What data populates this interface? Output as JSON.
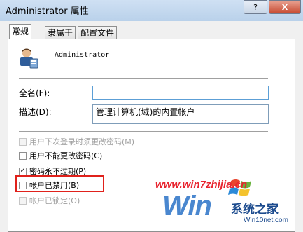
{
  "window": {
    "title": "Administrator 属性",
    "help_label": "?",
    "close_label": "X"
  },
  "tabs": [
    {
      "label": "常规",
      "active": true
    },
    {
      "label": "隶属于",
      "active": false
    },
    {
      "label": "配置文件",
      "active": false
    }
  ],
  "account": {
    "icon": "user-icon",
    "name": "Administrator"
  },
  "fields": {
    "full_name_label": "全名(F):",
    "full_name_value": "",
    "description_label": "描述(D):",
    "description_value": "管理计算机(域)的内置帐户"
  },
  "checkboxes": [
    {
      "label": "用户下次登录时须更改密码(M)",
      "checked": false,
      "enabled": false
    },
    {
      "label": "用户不能更改密码(C)",
      "checked": false,
      "enabled": true
    },
    {
      "label": "密码永不过期(P)",
      "checked": true,
      "enabled": true
    },
    {
      "label": "帐户已禁用(B)",
      "checked": false,
      "enabled": true
    },
    {
      "label": "帐户已锁定(O)",
      "checked": false,
      "enabled": false
    }
  ],
  "highlight_color": "#e0211b",
  "watermark": {
    "url": "www.win7zhijia.cn",
    "logo": "Win",
    "brand": "系统之家",
    "site": "Win10net.com"
  }
}
